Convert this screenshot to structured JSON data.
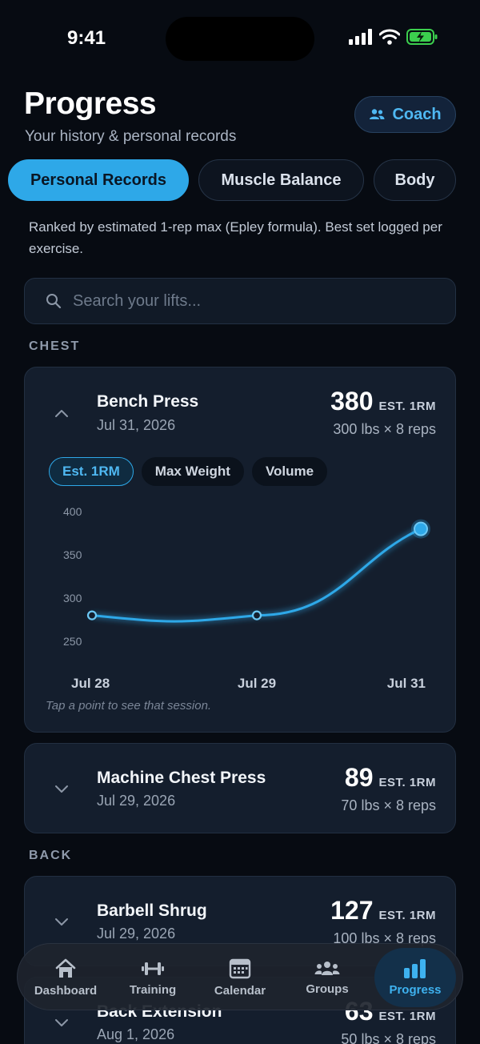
{
  "status": {
    "time": "9:41"
  },
  "header": {
    "title": "Progress",
    "subtitle": "Your history & personal records",
    "coach_label": "Coach"
  },
  "tabs": [
    {
      "label": "Personal Records",
      "active": true
    },
    {
      "label": "Muscle Balance",
      "active": false
    },
    {
      "label": "Body",
      "active": false
    }
  ],
  "description": "Ranked by estimated 1-rep max (Epley formula). Best set logged per exercise.",
  "search": {
    "placeholder": "Search your lifts..."
  },
  "sections": [
    {
      "label": "CHEST",
      "exercises": [
        {
          "name": "Bench Press",
          "date": "Jul 31, 2026",
          "rm": "380",
          "rm_unit": "EST. 1RM",
          "set": "300 lbs × 8 reps",
          "expanded": true
        },
        {
          "name": "Machine Chest Press",
          "date": "Jul 29, 2026",
          "rm": "89",
          "rm_unit": "EST. 1RM",
          "set": "70 lbs × 8 reps",
          "expanded": false
        }
      ]
    },
    {
      "label": "BACK",
      "exercises": [
        {
          "name": "Barbell Shrug",
          "date": "Jul 29, 2026",
          "rm": "127",
          "rm_unit": "EST. 1RM",
          "set": "100 lbs × 8 reps",
          "expanded": false
        },
        {
          "name": "Back Extension",
          "date": "Aug 1, 2026",
          "rm": "63",
          "rm_unit": "EST. 1RM",
          "set": "50 lbs × 8 reps",
          "expanded": false
        }
      ]
    }
  ],
  "chart_pills": [
    {
      "label": "Est. 1RM",
      "active": true
    },
    {
      "label": "Max Weight",
      "active": false
    },
    {
      "label": "Volume",
      "active": false
    }
  ],
  "chart_data": {
    "type": "line",
    "x": [
      "Jul 28",
      "Jul 29",
      "Jul 31"
    ],
    "values": [
      280,
      280,
      380
    ],
    "ylim": [
      250,
      400
    ],
    "yticks": [
      400,
      350,
      300,
      250
    ],
    "line_color": "#2ea8e8"
  },
  "chart_hint": "Tap a point to see that session.",
  "nav": [
    {
      "label": "Dashboard",
      "icon": "home-icon",
      "active": false
    },
    {
      "label": "Training",
      "icon": "dumbbell-icon",
      "active": false
    },
    {
      "label": "Calendar",
      "icon": "calendar-icon",
      "active": false
    },
    {
      "label": "Groups",
      "icon": "groups-icon",
      "active": false
    },
    {
      "label": "Progress",
      "icon": "bar-chart-icon",
      "active": true
    }
  ],
  "colors": {
    "accent": "#2ea8e8",
    "background": "#070b12",
    "card": "#141e2d"
  }
}
